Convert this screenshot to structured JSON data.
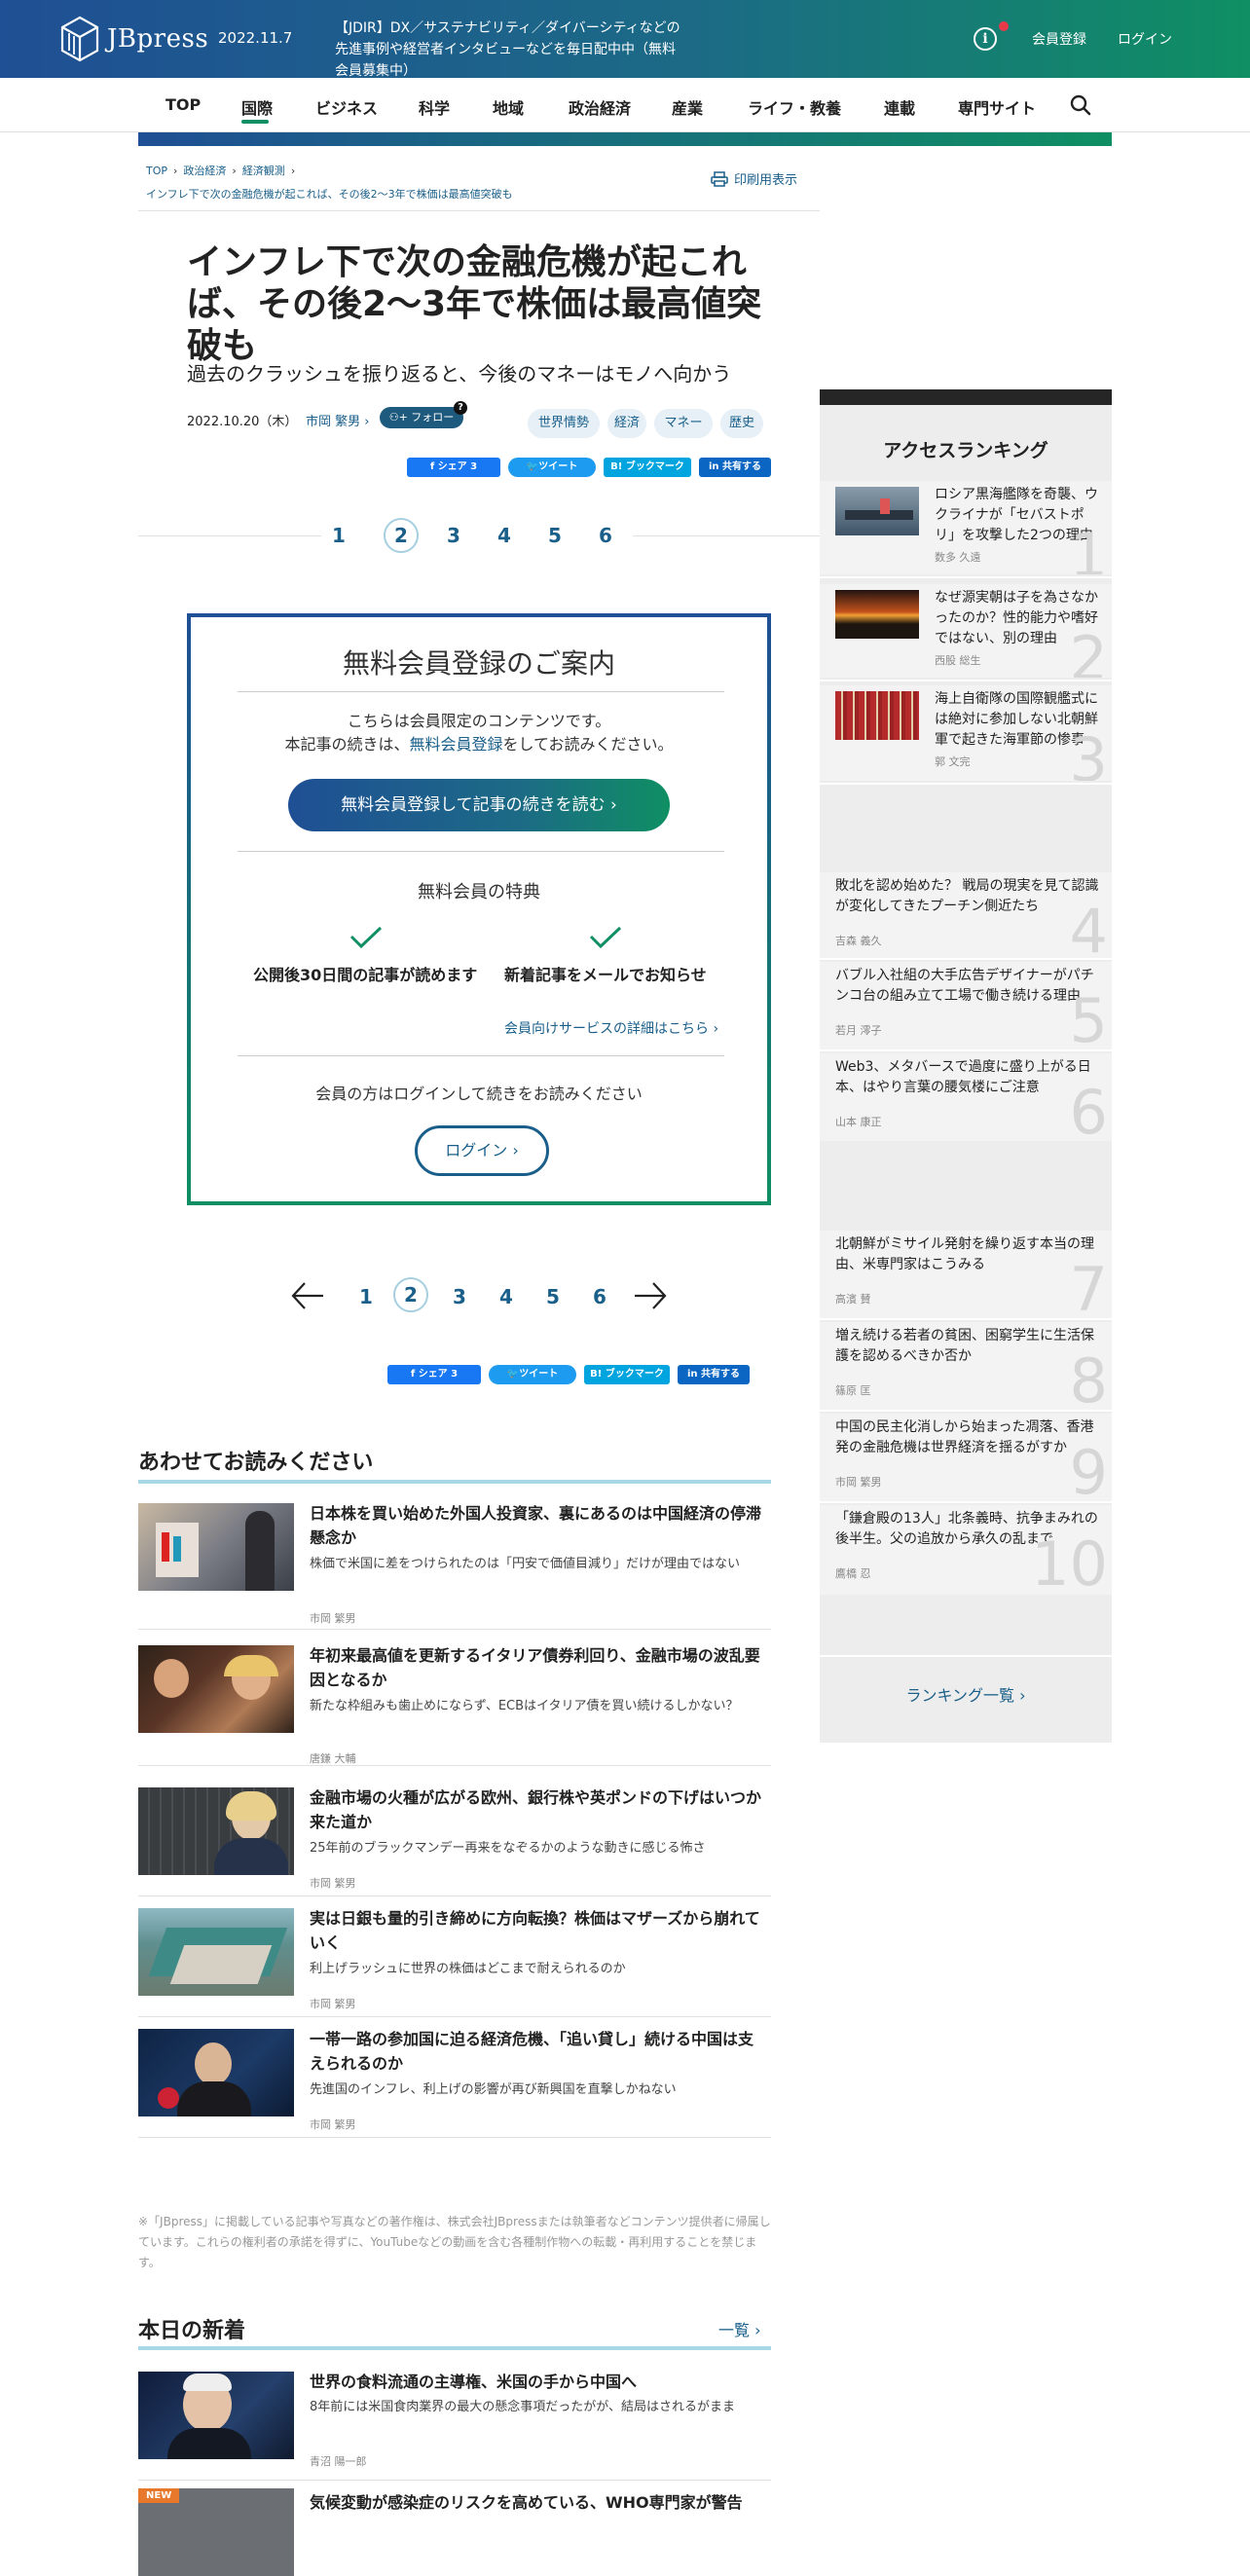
{
  "header": {
    "logo_text": "JBpress",
    "date": "2022.11.7",
    "notice": "【JDIR】DX／サステナビリティ／ダイバーシティなどの先進事例や経営者インタビューなどを毎日配中中（無料会員募集中）",
    "register": "会員登録",
    "login": "ログイン"
  },
  "nav": {
    "items": [
      "TOP",
      "国際",
      "ビジネス",
      "科学",
      "地域",
      "政治経済",
      "産業",
      "ライフ・教養",
      "連載",
      "専門サイト"
    ],
    "active": "国際"
  },
  "breadcrumb": {
    "items": [
      "TOP",
      "政治経済",
      "経済観測"
    ],
    "current": "インフレ下で次の金融危機が起これば、その後2～3年で株価は最高値突破も"
  },
  "print_label": "印刷用表示",
  "article": {
    "title": "インフレ下で次の金融危機が起これば、その後2～3年で株価は最高値突破も",
    "subtitle": "過去のクラッシュを振り返ると、今後のマネーはモノへ向かう",
    "date": "2022.10.20（木）",
    "author": "市岡 繁男",
    "follow": "フォロー",
    "tags": [
      "世界情勢",
      "経済",
      "マネー",
      "歴史"
    ]
  },
  "share": {
    "facebook": "シェア  3",
    "twitter": "ツイート",
    "hatena": "B! ブックマーク",
    "linkedin": "共有する"
  },
  "pager": {
    "pages": [
      "1",
      "2",
      "3",
      "4",
      "5",
      "6"
    ],
    "current": "2"
  },
  "member_box": {
    "title": "無料会員登録のご案内",
    "line1": "こちらは会員限定のコンテンツです。",
    "line2_pre": "本記事の続きは、",
    "line2_link": "無料会員登録",
    "line2_post": "をしてお読みください。",
    "cta": "無料会員登録して記事の続きを読む  ›",
    "benefit_title": "無料会員の特典",
    "benefit1": "公開後30日間の記事が読めます",
    "benefit2": "新着記事をメールでお知らせ",
    "service_link": "会員向けサービスの詳細はこちら  ›",
    "login_note": "会員の方はログインして続きをお読みください",
    "login_button": "ログイン  ›"
  },
  "related": {
    "title": "あわせてお読みください",
    "items": [
      {
        "headline": "日本株を買い始めた外国人投資家、裏にあるのは中国経済の停滞懸念か",
        "desc": "株価で米国に差をつけられたのは「円安で価値目減り」だけが理由ではない",
        "author": "市岡 繁男"
      },
      {
        "headline": "年初来最高値を更新するイタリア債券利回り、金融市場の波乱要因となるか",
        "desc": "新たな枠組みも歯止めにならず、ECBはイタリア債を買い続けるしかない？",
        "author": "唐鎌 大輔"
      },
      {
        "headline": "金融市場の火種が広がる欧州、銀行株や英ポンドの下げはいつか来た道か",
        "desc": "25年前のブラックマンデー再来をなぞるかのような動きに感じる怖さ",
        "author": "市岡 繁男"
      },
      {
        "headline": "実は日銀も量的引き締めに方向転換？株価はマザーズから崩れていく",
        "desc": "利上げラッシュに世界の株価はどこまで耐えられるのか",
        "author": "市岡 繁男"
      },
      {
        "headline": "一帯一路の参加国に迫る経済危機、「追い貸し」続ける中国は支えられるのか",
        "desc": "先進国のインフレ、利上げの影響が再び新興国を直撃しかねない",
        "author": "市岡 繁男"
      }
    ]
  },
  "copyright_notice": "※「JBpress」に掲載している記事や写真などの著作権は、株式会社JBpressまたは執筆者などコンテンツ提供者に帰属しています。これらの権利者の承諾を得ずに、YouTubeなどの動画を含む各種制作物への転載・再利用することを禁じます。",
  "today_new": {
    "title": "本日の新着",
    "list_link": "一覧  ›",
    "items": [
      {
        "headline": "世界の食料流通の主導権、米国の手から中国へ",
        "desc": "8年前には米国食肉業界の最大の懸念事項だったがが、結局はされるがまま",
        "author": "青沼 陽一郎"
      },
      {
        "badge": "NEW",
        "headline": "気候変動が感染症のリスクを高めている、WHO専門家が警告"
      }
    ]
  },
  "ranking": {
    "title": "アクセスランキング",
    "items": [
      {
        "rank": "1",
        "headline": "ロシア黒海艦隊を奇襲、ウクライナが「セバストポリ」を攻撃した2つの理由",
        "author": "数多 久遠"
      },
      {
        "rank": "2",
        "headline": "なぜ源実朝は子を為さなかったのか？性的能力や嗜好ではない、別の理由",
        "author": "西股 総生"
      },
      {
        "rank": "3",
        "headline": "海上自衛隊の国際観艦式には絶対に参加しない北朝鮮軍で起きた海軍節の惨事",
        "author": "郭 文完"
      },
      {
        "rank": "4",
        "headline": "敗北を認め始めた？ 戦局の現実を見て認識が変化してきたプーチン側近たち",
        "author": "吉森 義久"
      },
      {
        "rank": "5",
        "headline": "バブル入社組の大手広告デザイナーがパチンコ台の組み立て工場で働き続ける理由",
        "author": "若月 澪子"
      },
      {
        "rank": "6",
        "headline": "Web3、メタバースで過度に盛り上がる日本、はやり言葉の腰気楼にご注意",
        "author": "山本 康正"
      },
      {
        "rank": "7",
        "headline": "北朝鮮がミサイル発射を繰り返す本当の理由、米専門家はこうみる",
        "author": "高濱 賛"
      },
      {
        "rank": "8",
        "headline": "増え続ける若者の貧困、困窮学生に生活保護を認めるべきか否か",
        "author": "篠原 匡"
      },
      {
        "rank": "9",
        "headline": "中国の民主化消しから始まった凋落、香港発の金融危機は世界経済を揺るがすか",
        "author": "市岡 繁男"
      },
      {
        "rank": "10",
        "headline": "「鎌倉殿の13人」北条義時、抗争まみれの後半生。父の追放から承久の乱まで",
        "author": "鷹橋 忍"
      }
    ],
    "more": "ランキング一覧  ›"
  }
}
